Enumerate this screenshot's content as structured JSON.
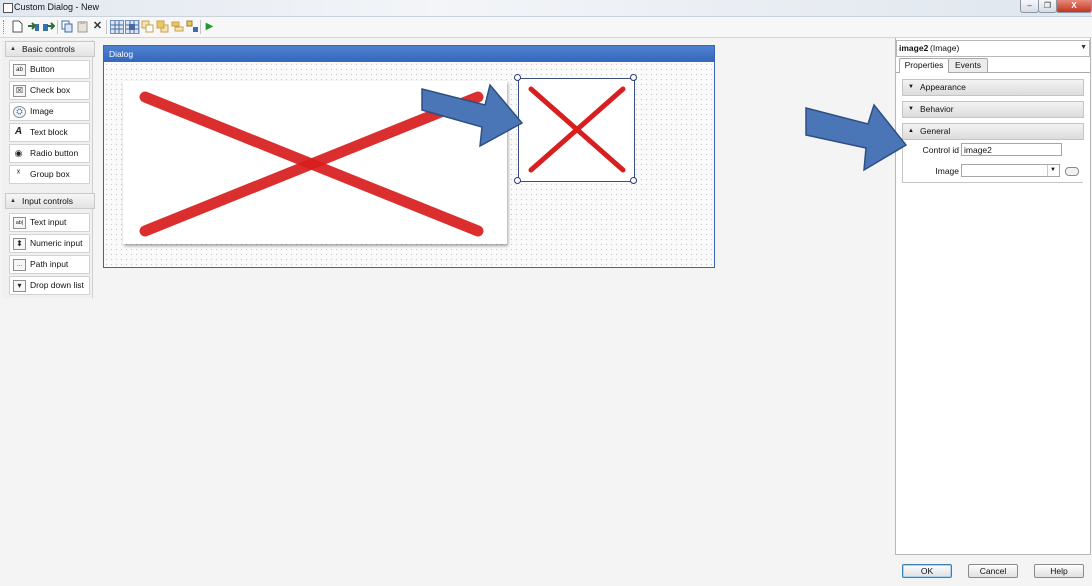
{
  "window": {
    "title": "Custom Dialog - New",
    "minimize_glyph": "–",
    "restore_glyph": "❐",
    "close_glyph": "X"
  },
  "toolbar": {
    "icons": [
      "new-document-icon",
      "import-icon",
      "export-icon",
      "copy-icon",
      "paste-icon",
      "delete-icon",
      "show-grid-icon",
      "snap-to-grid-icon",
      "bring-forward-icon",
      "send-backward-icon",
      "align-icon",
      "group-icon",
      "run-preview-icon"
    ]
  },
  "toolbox": {
    "basic_controls": {
      "label": "Basic controls",
      "items": [
        {
          "label": "Button",
          "icon_text": "ab"
        },
        {
          "label": "Check box",
          "icon_text": "☒"
        },
        {
          "label": "Image",
          "icon_text": "⛭"
        },
        {
          "label": "Text block",
          "icon_text": "A"
        },
        {
          "label": "Radio button",
          "icon_text": "◉"
        },
        {
          "label": "Group box",
          "icon_text": "ˣ"
        }
      ]
    },
    "input_controls": {
      "label": "Input controls",
      "items": [
        {
          "label": "Text input",
          "icon_text": "ab|"
        },
        {
          "label": "Numeric input",
          "icon_text": "⬍"
        },
        {
          "label": "Path input",
          "icon_text": "..."
        },
        {
          "label": "Drop down list",
          "icon_text": "▾"
        }
      ]
    }
  },
  "dialog": {
    "title": "Dialog",
    "x_color": "#d81e1e"
  },
  "properties": {
    "selected_name": "image2",
    "selected_type": "(Image)",
    "tabs": [
      "Properties",
      "Events"
    ],
    "active_tab": "Properties",
    "sections": [
      "Appearance",
      "Behavior",
      "General"
    ],
    "expanded_section": "General",
    "fields": {
      "control_id_label": "Control id",
      "control_id_value": "image2",
      "image_label": "Image",
      "image_value": ""
    }
  },
  "buttons": {
    "ok": "OK",
    "cancel": "Cancel",
    "help": "Help"
  },
  "annotations": {
    "arrow_color": "#4a76b8"
  }
}
